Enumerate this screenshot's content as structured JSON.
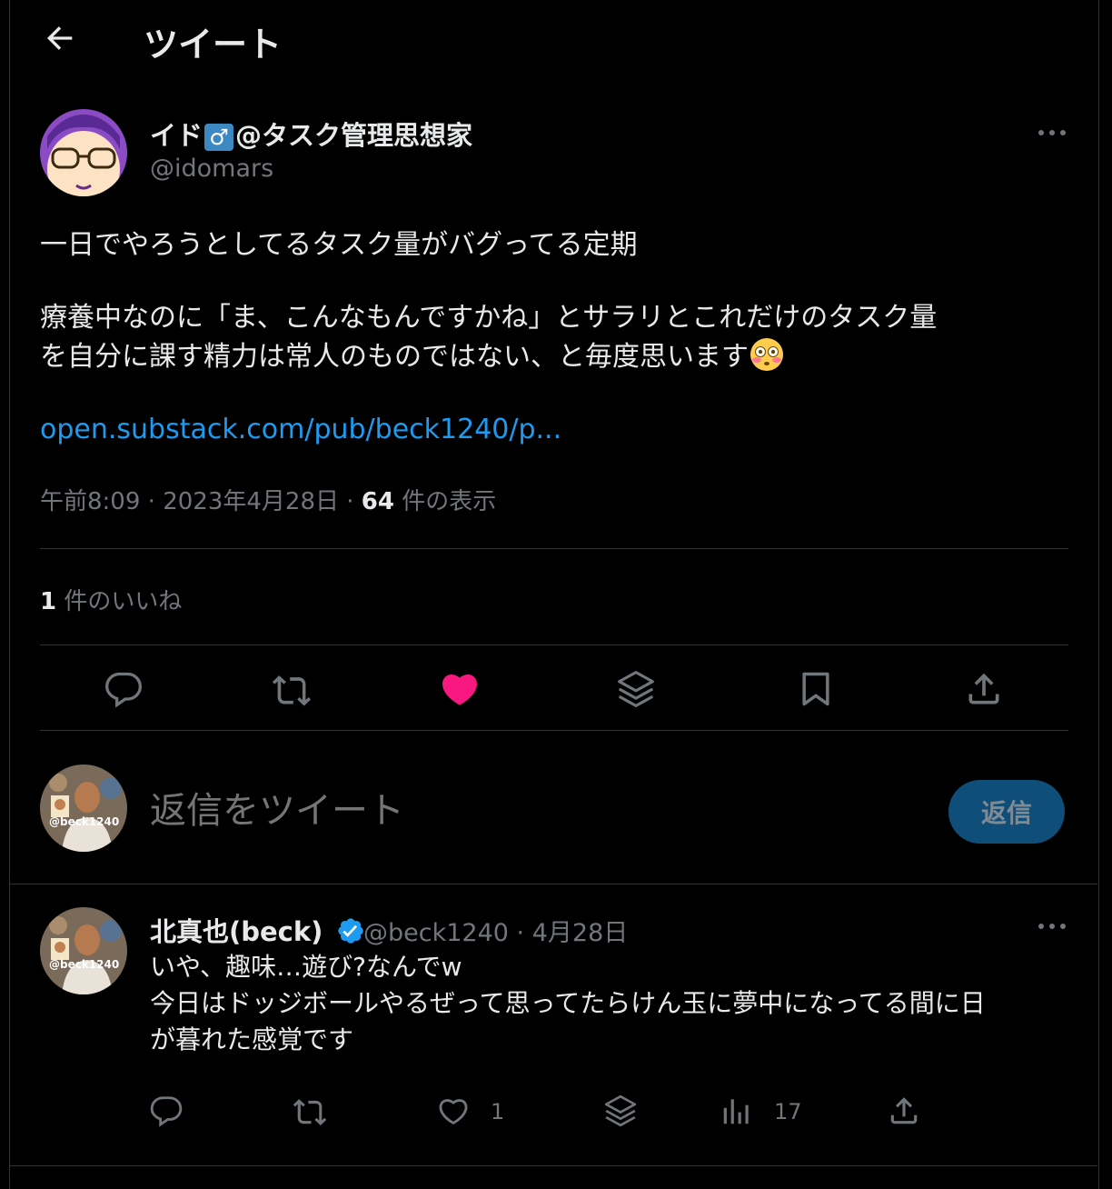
{
  "header": {
    "title": "ツイート"
  },
  "tweet": {
    "author_name_prefix": "イド",
    "author_name_suffix": "@タスク管理思想家",
    "author_handle": "@idomars",
    "text_line1": "一日でやろうとしてるタスク量がバグってる定期",
    "text_line2": "療養中なのに「ま、こんなもんですかね」とサラリとこれだけのタスク量",
    "text_line3": "を自分に課す精力は常人のものではない、と毎度思います",
    "link": "open.substack.com/pub/beck1240/p...",
    "time": "午前8:09",
    "date": "2023年4月28日",
    "views_count": "64",
    "views_label": "件の表示",
    "likes_count": "1",
    "likes_label": "件のいいね"
  },
  "reply_box": {
    "placeholder": "返信をツイート",
    "button_label": "返信",
    "avatar_tag": "@beck1240"
  },
  "comment": {
    "author_name": "北真也(beck)",
    "author_handle": "@beck1240",
    "date": "4月28日",
    "avatar_tag": "@beck1240",
    "text_line1": "いや、趣味…遊び?なんでw",
    "text_line2": "今日はドッジボールやるぜって思ってたらけん玉に夢中になってる間に日",
    "text_line3": "が暮れた感覚です",
    "like_count": "1",
    "view_count": "17"
  },
  "colors": {
    "background": "#000000",
    "accent_link": "#1d9bf0",
    "like_active": "#f91880",
    "verified": "#1d9bf0",
    "muted_text": "#71767b"
  },
  "icons": [
    "back-arrow-icon",
    "more-icon",
    "reply-icon",
    "retweet-icon",
    "like-icon",
    "layers-icon",
    "bookmark-icon",
    "share-icon",
    "verified-icon",
    "analytics-icon",
    "flushed-face-icon"
  ]
}
